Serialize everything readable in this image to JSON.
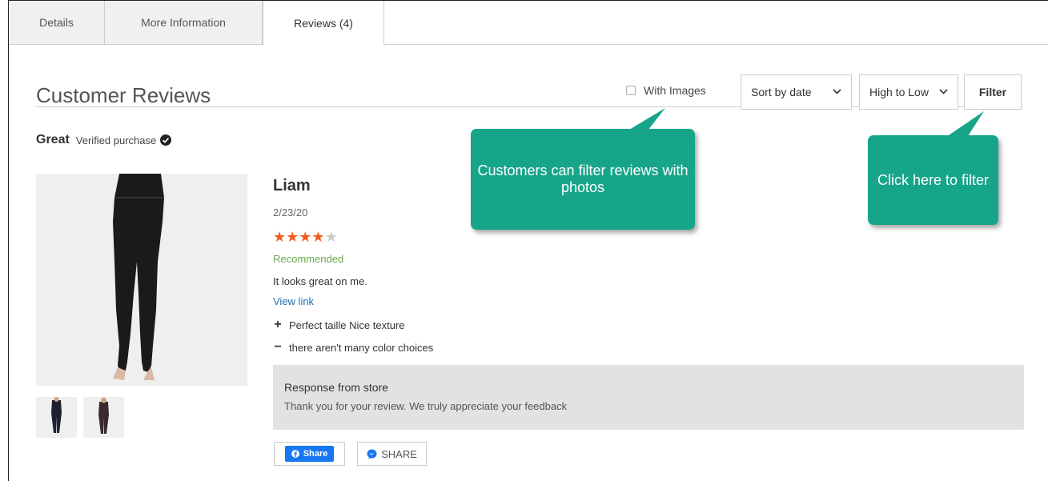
{
  "tabs": [
    {
      "label": "Details"
    },
    {
      "label": "More Information"
    },
    {
      "label": "Reviews (4)"
    }
  ],
  "header": {
    "title": "Customer Reviews",
    "with_images_label": "With Images",
    "sort_label": "Sort by date",
    "order_label": "High to Low",
    "filter_label": "Filter"
  },
  "review": {
    "headline": "Great",
    "verified_label": "Verified purchase",
    "reviewer": "Liam",
    "date": "2/23/20",
    "rating": 4,
    "rating_max": 5,
    "recommended": "Recommended",
    "text": "It looks great on me.",
    "link": "View link",
    "pro": "Perfect taille Nice texture",
    "con": "there aren't many color choices",
    "response_title": "Response from store",
    "response_body": "Thank you for your review. We truly appreciate your feedback",
    "fb_share": "Share",
    "messenger_share": "SHARE"
  },
  "callouts": {
    "images": "Customers can filter reviews with photos",
    "filter": "Click here to filter"
  },
  "colors": {
    "callout": "#17a589",
    "star": "#f25a1e",
    "recommended": "#6aa84f",
    "link": "#1f6fb5",
    "facebook": "#1877f2"
  }
}
